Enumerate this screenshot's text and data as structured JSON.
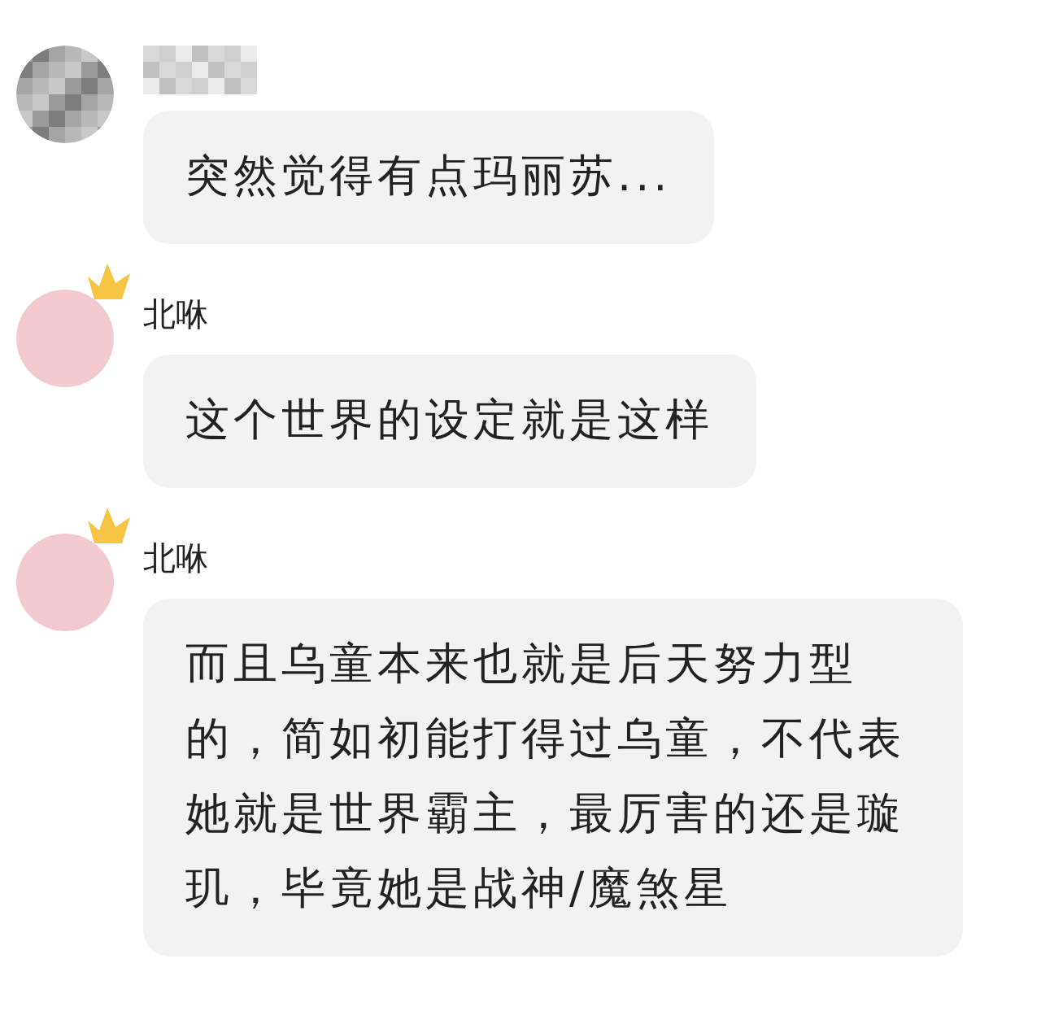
{
  "messages": [
    {
      "sender_hidden": true,
      "crown": false,
      "text": "突然觉得有点玛丽苏..."
    },
    {
      "sender_hidden": false,
      "sender": "北咻",
      "crown": true,
      "text": "这个世界的设定就是这样"
    },
    {
      "sender_hidden": false,
      "sender": "北咻",
      "crown": true,
      "text": "而且乌童本来也就是后天努力型的，简如初能打得过乌童，不代表她就是世界霸主，最厉害的还是璇玑，毕竟她是战神/魔煞星"
    }
  ]
}
